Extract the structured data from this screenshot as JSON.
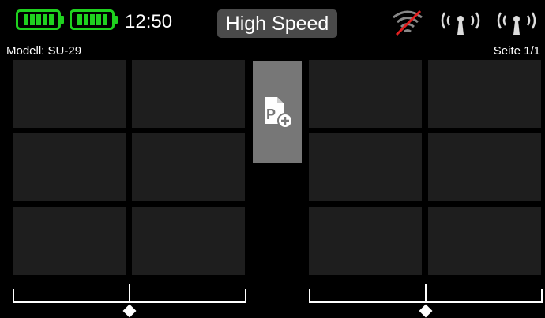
{
  "status_bar": {
    "time": "12:50",
    "mode": "High Speed",
    "battery_color": "#1fd11f"
  },
  "header": {
    "model_label": "Modell: SU-29",
    "page_label": "Seite 1/1"
  },
  "add_page_icon": "page-add-icon",
  "colors": {
    "tile": "#1e1e1e",
    "add_page_bg": "#777777",
    "mode_badge_bg": "#4a4a4a",
    "no_signal_slash": "#e02020"
  }
}
